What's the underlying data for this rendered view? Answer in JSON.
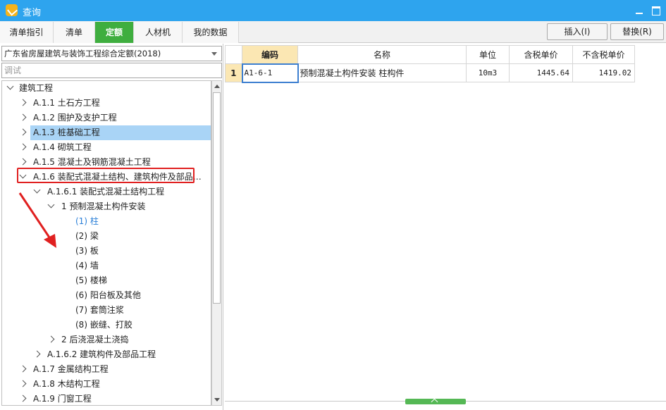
{
  "window": {
    "title": "查询"
  },
  "tabs": [
    {
      "label": "清单指引",
      "active": false
    },
    {
      "label": "清单",
      "active": false
    },
    {
      "label": "定额",
      "active": true
    },
    {
      "label": "人材机",
      "active": false
    },
    {
      "label": "我的数据",
      "active": false
    }
  ],
  "actions": {
    "insert": "插入(I)",
    "replace": "替换(R)"
  },
  "left": {
    "quota_select": "广东省房屋建筑与装饰工程综合定额(2018)",
    "search_value": "调试"
  },
  "tree": [
    {
      "text": "建筑工程",
      "state": "expanded"
    },
    {
      "text": "A.1.1 土石方工程",
      "state": "collapsed"
    },
    {
      "text": "A.1.2 围护及支护工程",
      "state": "collapsed"
    },
    {
      "text": "A.1.3 桩基础工程",
      "state": "collapsed",
      "highlight": true
    },
    {
      "text": "A.1.4 砌筑工程",
      "state": "collapsed"
    },
    {
      "text": "A.1.5 混凝土及钢筋混凝土工程",
      "state": "collapsed"
    },
    {
      "text": "A.1.6 装配式混凝土结构、建筑构件及部品…",
      "state": "expanded",
      "boxed": true
    },
    {
      "text": "A.1.6.1 装配式混凝土结构工程",
      "state": "expanded"
    },
    {
      "text": "1 预制混凝土构件安装",
      "state": "expanded"
    },
    {
      "text": "(1) 柱",
      "state": "leaf",
      "selected": true
    },
    {
      "text": "(2) 梁",
      "state": "leaf"
    },
    {
      "text": "(3) 板",
      "state": "leaf"
    },
    {
      "text": "(4) 墙",
      "state": "leaf"
    },
    {
      "text": "(5) 楼梯",
      "state": "leaf"
    },
    {
      "text": "(6) 阳台板及其他",
      "state": "leaf"
    },
    {
      "text": "(7) 套筒注浆",
      "state": "leaf"
    },
    {
      "text": "(8) 嵌缝、打胶",
      "state": "leaf"
    },
    {
      "text": "2 后浇混凝土浇捣",
      "state": "collapsed"
    },
    {
      "text": "A.1.6.2 建筑构件及部品工程",
      "state": "collapsed"
    },
    {
      "text": "A.1.7 金属结构工程",
      "state": "collapsed"
    },
    {
      "text": "A.1.8 木结构工程",
      "state": "collapsed"
    },
    {
      "text": "A.1.9 门窗工程",
      "state": "collapsed"
    }
  ],
  "grid": {
    "headers": [
      "编码",
      "名称",
      "单位",
      "含税单价",
      "不含税单价"
    ],
    "rows": [
      {
        "num": "1",
        "code": "A1-6-1",
        "name": "预制混凝土构件安装 柱构件",
        "unit": "10m3",
        "tax_price": "1445.64",
        "notax_price": "1419.02"
      }
    ]
  },
  "colors": {
    "titlebar": "#2ea4ee",
    "active_tab": "#3fae3f",
    "highlight": "#a9d4f6",
    "annotation": "#e02020"
  }
}
